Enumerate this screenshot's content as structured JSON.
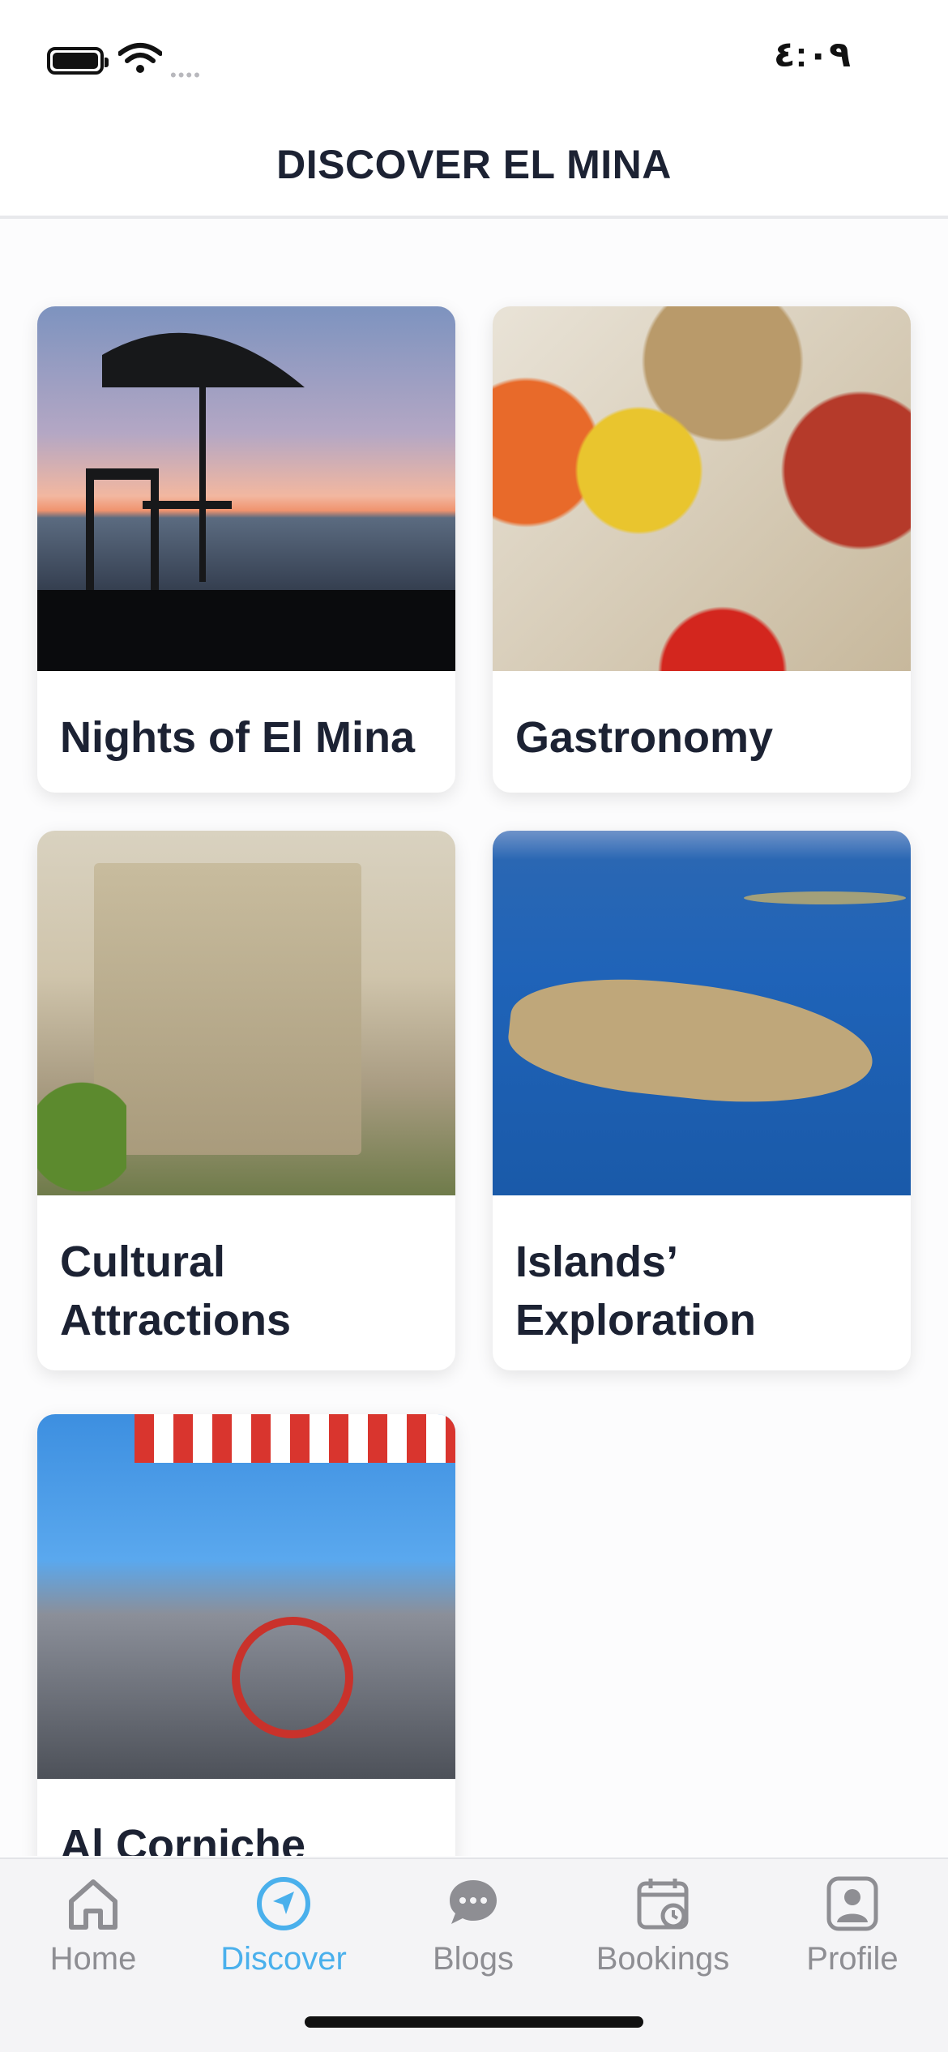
{
  "status_bar": {
    "time": "٤:٠٩",
    "signal_dots": "••••"
  },
  "header": {
    "title": "DISCOVER EL MINA"
  },
  "cards": [
    {
      "title": "Nights of El Mina",
      "image": "sunset-terrace-photo"
    },
    {
      "title": "Gastronomy",
      "image": "nuts-and-sweets-bags-photo"
    },
    {
      "title": "Cultural Attractions",
      "image": "old-stone-tower-photo"
    },
    {
      "title": "Islands’ Exploration",
      "image": "island-aerial-photo"
    },
    {
      "title": "Al Corniche",
      "image": "corniche-bikes-photo"
    }
  ],
  "tabbar": {
    "active_color": "#4ab0ec",
    "items": [
      {
        "label": "Home",
        "icon": "home-icon",
        "active": false
      },
      {
        "label": "Discover",
        "icon": "compass-icon",
        "active": true
      },
      {
        "label": "Blogs",
        "icon": "chat-bubble-icon",
        "active": false
      },
      {
        "label": "Bookings",
        "icon": "calendar-clock-icon",
        "active": false
      },
      {
        "label": "Profile",
        "icon": "profile-icon",
        "active": false
      }
    ]
  }
}
